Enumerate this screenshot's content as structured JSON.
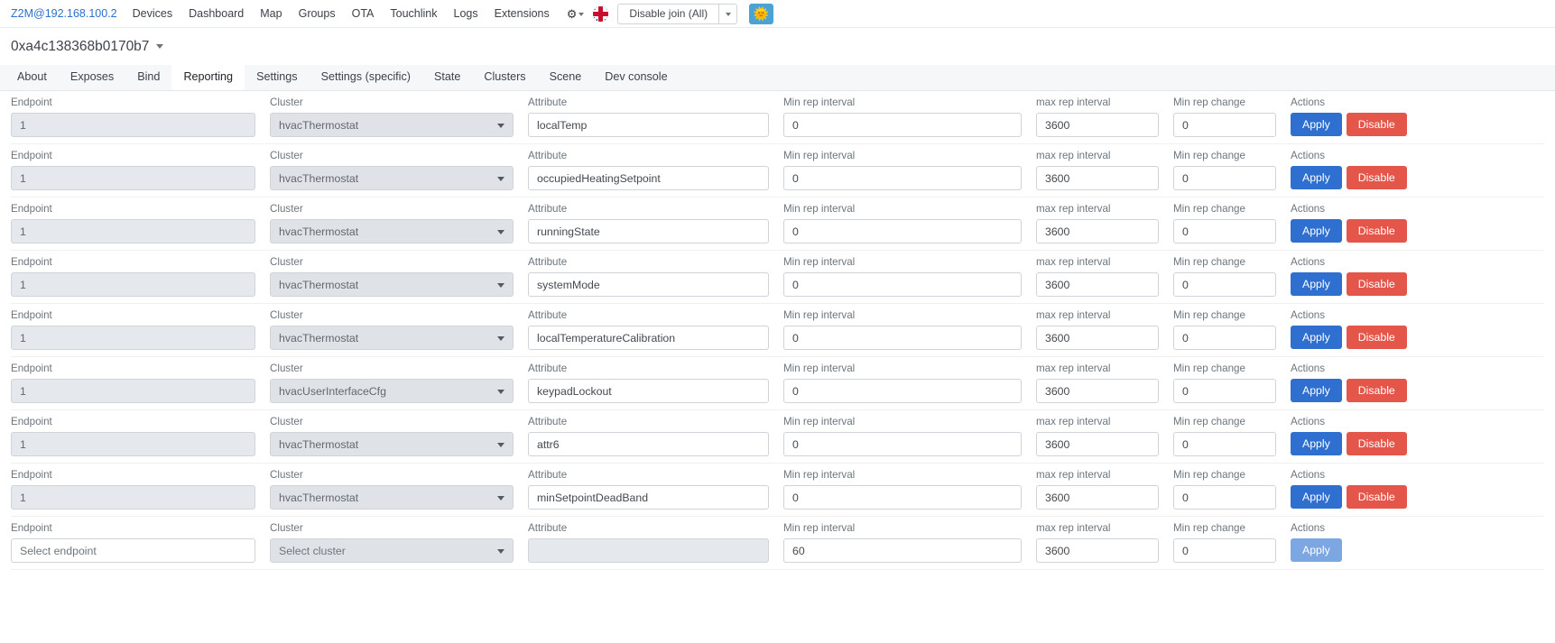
{
  "navbar": {
    "brand": "Z2M@192.168.100.2",
    "links": [
      "Devices",
      "Dashboard",
      "Map",
      "Groups",
      "OTA",
      "Touchlink",
      "Logs",
      "Extensions"
    ],
    "settings_icon": "gear-icon",
    "language_icon": "uk-flag-icon",
    "join_button": "Disable join (All)",
    "theme_icon": "sun-icon",
    "theme_bg_color": "#4ba3d3",
    "brand_color": "#2f6fd0"
  },
  "device": {
    "title": "0xa4c138368b0170b7"
  },
  "tabs": [
    {
      "label": "About",
      "active": false
    },
    {
      "label": "Exposes",
      "active": false
    },
    {
      "label": "Bind",
      "active": false
    },
    {
      "label": "Reporting",
      "active": true
    },
    {
      "label": "Settings",
      "active": false
    },
    {
      "label": "Settings (specific)",
      "active": false
    },
    {
      "label": "State",
      "active": false
    },
    {
      "label": "Clusters",
      "active": false
    },
    {
      "label": "Scene",
      "active": false
    },
    {
      "label": "Dev console",
      "active": false
    }
  ],
  "labels": {
    "endpoint": "Endpoint",
    "cluster": "Cluster",
    "attribute": "Attribute",
    "min_rep_interval": "Min rep interval",
    "max_rep_interval": "max rep interval",
    "min_rep_change": "Min rep change",
    "actions": "Actions"
  },
  "buttons": {
    "apply": "Apply",
    "disable": "Disable",
    "apply_color": "#2f6fd0",
    "disable_color": "#e4564a"
  },
  "placeholders": {
    "endpoint": "Select endpoint",
    "cluster": "Select cluster",
    "attribute": ""
  },
  "rows": [
    {
      "endpoint": "1",
      "cluster": "hvacThermostat",
      "attribute": "localTemp",
      "min_rep_interval": "0",
      "max_rep_interval": "3600",
      "min_rep_change": "0"
    },
    {
      "endpoint": "1",
      "cluster": "hvacThermostat",
      "attribute": "occupiedHeatingSetpoint",
      "min_rep_interval": "0",
      "max_rep_interval": "3600",
      "min_rep_change": "0"
    },
    {
      "endpoint": "1",
      "cluster": "hvacThermostat",
      "attribute": "runningState",
      "min_rep_interval": "0",
      "max_rep_interval": "3600",
      "min_rep_change": "0"
    },
    {
      "endpoint": "1",
      "cluster": "hvacThermostat",
      "attribute": "systemMode",
      "min_rep_interval": "0",
      "max_rep_interval": "3600",
      "min_rep_change": "0"
    },
    {
      "endpoint": "1",
      "cluster": "hvacThermostat",
      "attribute": "localTemperatureCalibration",
      "min_rep_interval": "0",
      "max_rep_interval": "3600",
      "min_rep_change": "0"
    },
    {
      "endpoint": "1",
      "cluster": "hvacUserInterfaceCfg",
      "attribute": "keypadLockout",
      "min_rep_interval": "0",
      "max_rep_interval": "3600",
      "min_rep_change": "0"
    },
    {
      "endpoint": "1",
      "cluster": "hvacThermostat",
      "attribute": "attr6",
      "min_rep_interval": "0",
      "max_rep_interval": "3600",
      "min_rep_change": "0"
    },
    {
      "endpoint": "1",
      "cluster": "hvacThermostat",
      "attribute": "minSetpointDeadBand",
      "min_rep_interval": "0",
      "max_rep_interval": "3600",
      "min_rep_change": "0"
    }
  ],
  "new_row": {
    "endpoint": "Select endpoint",
    "cluster": "Select cluster",
    "attribute": "",
    "min_rep_interval": "60",
    "max_rep_interval": "3600",
    "min_rep_change": "0"
  }
}
